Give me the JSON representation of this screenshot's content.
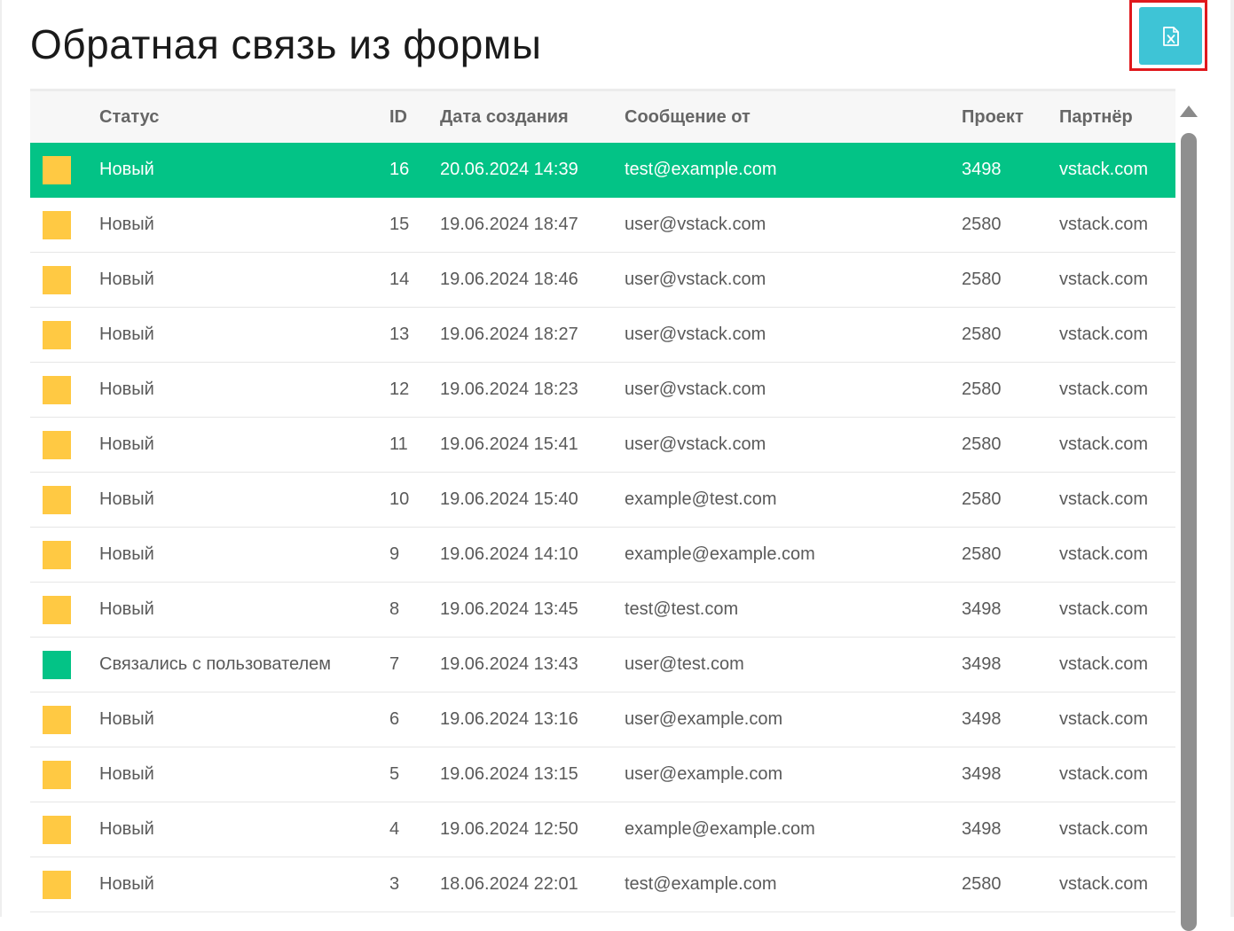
{
  "page": {
    "title": "Обратная связь из формы",
    "export_icon": "excel-file-icon",
    "colors": {
      "accent_green": "#03c386",
      "status_new": "#ffc943",
      "status_contacted": "#03c386",
      "export_button": "#3ec4d6",
      "highlight_frame": "#e0191d"
    }
  },
  "table": {
    "headers": {
      "status": "Статус",
      "id": "ID",
      "date": "Дата создания",
      "from": "Сообщение от",
      "project": "Проект",
      "partner": "Партнёр"
    },
    "rows": [
      {
        "color": "#ffc943",
        "status": "Новый",
        "id": "16",
        "date": "20.06.2024 14:39",
        "from": "test@example.com",
        "project": "3498",
        "partner": "vstack.com",
        "selected": true
      },
      {
        "color": "#ffc943",
        "status": "Новый",
        "id": "15",
        "date": "19.06.2024 18:47",
        "from": "user@vstack.com",
        "project": "2580",
        "partner": "vstack.com"
      },
      {
        "color": "#ffc943",
        "status": "Новый",
        "id": "14",
        "date": "19.06.2024 18:46",
        "from": "user@vstack.com",
        "project": "2580",
        "partner": "vstack.com"
      },
      {
        "color": "#ffc943",
        "status": "Новый",
        "id": "13",
        "date": "19.06.2024 18:27",
        "from": "user@vstack.com",
        "project": "2580",
        "partner": "vstack.com"
      },
      {
        "color": "#ffc943",
        "status": "Новый",
        "id": "12",
        "date": "19.06.2024 18:23",
        "from": "user@vstack.com",
        "project": "2580",
        "partner": "vstack.com"
      },
      {
        "color": "#ffc943",
        "status": "Новый",
        "id": "11",
        "date": "19.06.2024 15:41",
        "from": "user@vstack.com",
        "project": "2580",
        "partner": "vstack.com"
      },
      {
        "color": "#ffc943",
        "status": "Новый",
        "id": "10",
        "date": "19.06.2024 15:40",
        "from": "example@test.com",
        "project": "2580",
        "partner": "vstack.com"
      },
      {
        "color": "#ffc943",
        "status": "Новый",
        "id": "9",
        "date": "19.06.2024 14:10",
        "from": "example@example.com",
        "project": "2580",
        "partner": "vstack.com"
      },
      {
        "color": "#ffc943",
        "status": "Новый",
        "id": "8",
        "date": "19.06.2024 13:45",
        "from": "test@test.com",
        "project": "3498",
        "partner": "vstack.com"
      },
      {
        "color": "#03c386",
        "status": "Связались с пользователем",
        "id": "7",
        "date": "19.06.2024 13:43",
        "from": "user@test.com",
        "project": "3498",
        "partner": "vstack.com"
      },
      {
        "color": "#ffc943",
        "status": "Новый",
        "id": "6",
        "date": "19.06.2024 13:16",
        "from": "user@example.com",
        "project": "3498",
        "partner": "vstack.com"
      },
      {
        "color": "#ffc943",
        "status": "Новый",
        "id": "5",
        "date": "19.06.2024 13:15",
        "from": "user@example.com",
        "project": "3498",
        "partner": "vstack.com"
      },
      {
        "color": "#ffc943",
        "status": "Новый",
        "id": "4",
        "date": "19.06.2024 12:50",
        "from": "example@example.com",
        "project": "3498",
        "partner": "vstack.com"
      },
      {
        "color": "#ffc943",
        "status": "Новый",
        "id": "3",
        "date": "18.06.2024 22:01",
        "from": "test@example.com",
        "project": "2580",
        "partner": "vstack.com"
      }
    ]
  }
}
